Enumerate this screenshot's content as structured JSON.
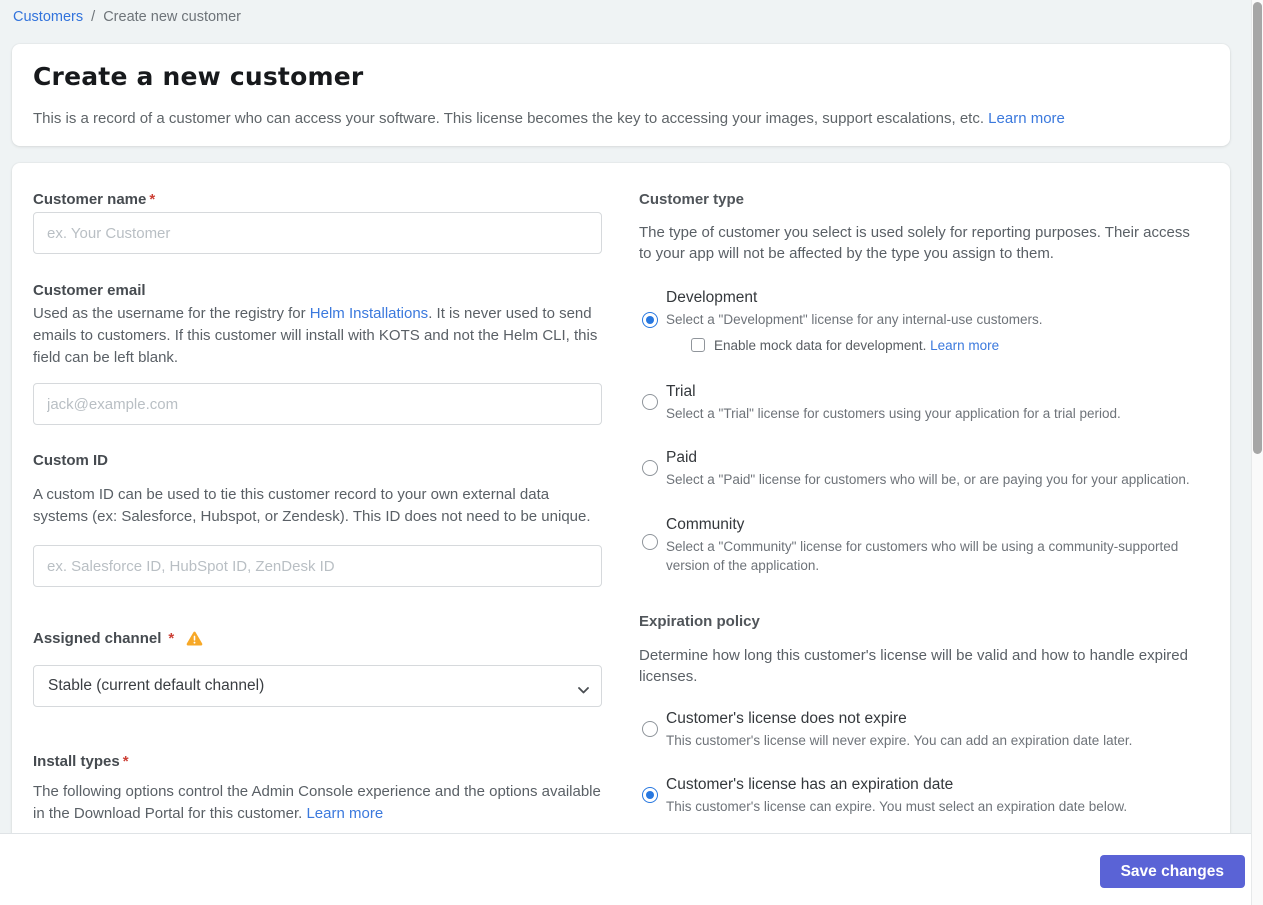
{
  "colors": {
    "link": "#3b79dd",
    "accent_button": "#5a63d6",
    "radio_selected": "#2878e0",
    "warning": "#f7a827",
    "page_bg": "#eff3f4"
  },
  "breadcrumb": {
    "customers": "Customers",
    "separator": "/",
    "current": "Create new customer"
  },
  "header": {
    "title": "Create a new customer",
    "subtitle": "This is a record of a customer who can access your software. This license becomes the key to accessing your images, support escalations, etc.",
    "learn_more": "Learn more"
  },
  "left": {
    "customer_name": {
      "label": "Customer name",
      "required_mark": "*",
      "placeholder": "ex. Your Customer"
    },
    "customer_email": {
      "label": "Customer email",
      "desc_before": "Used as the username for the registry for ",
      "desc_link": "Helm Installations",
      "desc_after": ". It is never used to send emails to customers. If this customer will install with KOTS and not the Helm CLI, this field can be left blank.",
      "placeholder": "jack@example.com"
    },
    "custom_id": {
      "label": "Custom ID",
      "description": "A custom ID can be used to tie this customer record to your own external data systems (ex: Salesforce, Hubspot, or Zendesk). This ID does not need to be unique.",
      "placeholder": "ex. Salesforce ID, HubSpot ID, ZenDesk ID"
    },
    "assigned_channel": {
      "label": "Assigned channel",
      "required_mark": "*",
      "selected_option": "Stable (current default channel)"
    },
    "install_types": {
      "label": "Install types",
      "required_mark": "*",
      "desc_before": "The following options control the Admin Console experience and the options available in the Download Portal for this customer. ",
      "desc_link": "Learn more"
    }
  },
  "customer_type": {
    "heading": "Customer type",
    "intro": "The type of customer you select is used solely for reporting purposes. Their access to your app will not be affected by the type you assign to them.",
    "options": [
      {
        "label": "Development",
        "description": "Select a \"Development\" license for any internal-use customers.",
        "selected": true
      },
      {
        "label": "Trial",
        "description": "Select a \"Trial\" license for customers using your application for a trial period.",
        "selected": false
      },
      {
        "label": "Paid",
        "description": "Select a \"Paid\" license for customers who will be, or are paying you for your application.",
        "selected": false
      },
      {
        "label": "Community",
        "description": "Select a \"Community\" license for customers who will be using a community-supported version of the application.",
        "selected": false
      }
    ],
    "mock_checkbox": {
      "label": "Enable mock data for development. ",
      "link": "Learn more",
      "checked": false
    }
  },
  "expiration": {
    "heading": "Expiration policy",
    "intro": "Determine how long this customer's license will be valid and how to handle expired licenses.",
    "options": [
      {
        "label": "Customer's license does not expire",
        "description": "This customer's license will never expire. You can add an expiration date later.",
        "selected": false
      },
      {
        "label": "Customer's license has an expiration date",
        "description": "This customer's license can expire. You must select an expiration date below.",
        "selected": true
      }
    ]
  },
  "footer": {
    "save_label": "Save changes"
  }
}
